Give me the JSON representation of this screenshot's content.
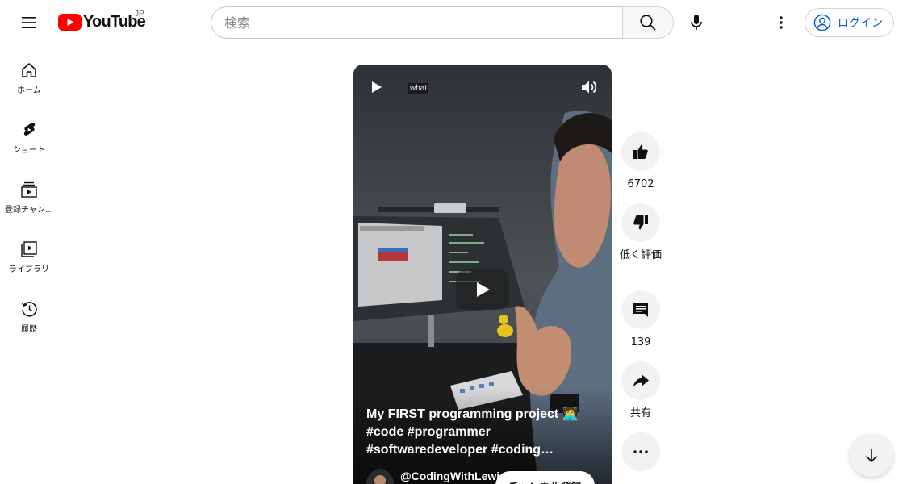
{
  "header": {
    "logo_text": "YouTube",
    "region": "JP",
    "search_placeholder": "検索",
    "login_label": "ログイン"
  },
  "sidebar": {
    "items": [
      {
        "label": "ホーム",
        "icon": "home-icon"
      },
      {
        "label": "ショート",
        "icon": "shorts-icon"
      },
      {
        "label": "登録チャン…",
        "icon": "subscriptions-icon"
      },
      {
        "label": "ライブラリ",
        "icon": "library-icon"
      },
      {
        "label": "履歴",
        "icon": "history-icon"
      }
    ]
  },
  "video": {
    "overlay_tag": "what",
    "title_lines": [
      "My FIRST programming project 🧑‍💻",
      "#code #programmer",
      "#softwaredeveloper #coding…"
    ],
    "channel_name": "@CodingWithLewi",
    "subscribe_label": "チャンネル登録"
  },
  "actions": {
    "like_count": "6702",
    "dislike_label": "低く評価",
    "comment_count": "139",
    "share_label": "共有"
  },
  "colors": {
    "brand_red": "#ff0000",
    "link_blue": "#065fd4",
    "chip_bg": "#f2f2f2"
  }
}
